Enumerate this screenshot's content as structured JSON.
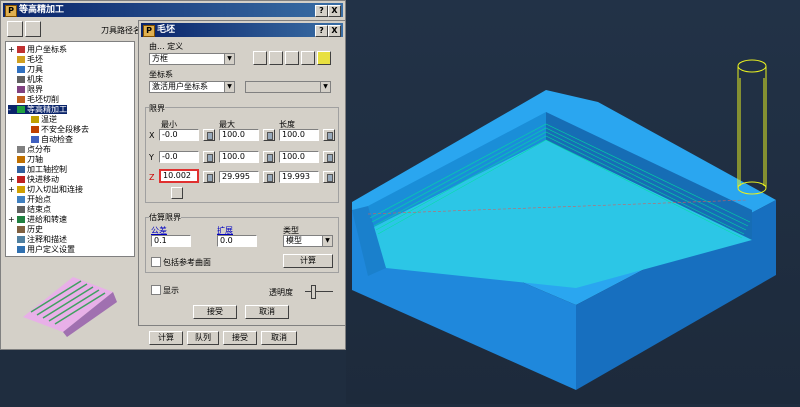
{
  "main_window": {
    "title": "等高精加工",
    "help_btn": "?",
    "close_btn": "X",
    "strategy_label": "刀具路径名称"
  },
  "tree": {
    "items": [
      {
        "label": "用户坐标系",
        "indent": 0,
        "exp": "+"
      },
      {
        "label": "毛坯",
        "indent": 0,
        "exp": ""
      },
      {
        "label": "刀具",
        "indent": 0,
        "exp": ""
      },
      {
        "label": "机床",
        "indent": 0,
        "exp": ""
      },
      {
        "label": "限界",
        "indent": 0,
        "exp": ""
      },
      {
        "label": "毛坯切削",
        "indent": 0,
        "exp": ""
      },
      {
        "label": "等高精加工",
        "indent": 0,
        "exp": "-"
      },
      {
        "label": "温逆",
        "indent": 1,
        "exp": ""
      },
      {
        "label": "不安全段移去",
        "indent": 1,
        "exp": ""
      },
      {
        "label": "自动检查",
        "indent": 1,
        "exp": ""
      },
      {
        "label": "点分布",
        "indent": 0,
        "exp": ""
      },
      {
        "label": "刀轴",
        "indent": 0,
        "exp": ""
      },
      {
        "label": "加工轴控制",
        "indent": 0,
        "exp": ""
      },
      {
        "label": "快进移动",
        "indent": 0,
        "exp": "+"
      },
      {
        "label": "切入切出和连接",
        "indent": 0,
        "exp": "+"
      },
      {
        "label": "开始点",
        "indent": 0,
        "exp": ""
      },
      {
        "label": "结束点",
        "indent": 0,
        "exp": ""
      },
      {
        "label": "进给和转速",
        "indent": 0,
        "exp": "+"
      },
      {
        "label": "历史",
        "indent": 0,
        "exp": ""
      },
      {
        "label": "注释和描述",
        "indent": 0,
        "exp": ""
      },
      {
        "label": "用户定义设置",
        "indent": 0,
        "exp": ""
      }
    ]
  },
  "bottom_buttons": {
    "calc": "计算",
    "queue": "队列",
    "accept": "接受",
    "cancel": "取消"
  },
  "dialog": {
    "title": "毛坯",
    "help_btn": "?",
    "close_btn": "X",
    "defined_by_label": "由... 定义",
    "defined_by_value": "方框",
    "coord_group_label": "坐标系",
    "coord_value": "激活用户坐标系",
    "coord_value2": "",
    "limits_group_label": "限界",
    "col_min": "最小",
    "col_max": "最大",
    "col_len": "长度",
    "rows": [
      {
        "axis": "X",
        "min": "-0.0",
        "max": "100.0",
        "len": "100.0"
      },
      {
        "axis": "Y",
        "min": "-0.0",
        "max": "100.0",
        "len": "100.0"
      },
      {
        "axis": "Z",
        "min": "10.002",
        "max": "29.995",
        "len": "19.993"
      }
    ],
    "calc_limits_group_label": "估算限界",
    "tolerance_label": "公差",
    "tolerance_value": "0.1",
    "expand_label": "扩展",
    "expand_value": "0.0",
    "type_label": "类型",
    "type_value": "模型",
    "include_ref_label": "包括参考曲面",
    "calc_btn": "计算",
    "show_label": "显示",
    "transparency_label": "透明度",
    "accept_btn": "接受",
    "cancel_btn": "取消",
    "highlight_color": "#e03030"
  },
  "colors": {
    "viewport_bg": "#1f2d3f",
    "part_top": "#2aa6f0",
    "part_side": "#1a7fd0",
    "pocket_floor": "#2fc8e0",
    "toolpath": "#00e0a0",
    "tool": "#e8f020"
  }
}
